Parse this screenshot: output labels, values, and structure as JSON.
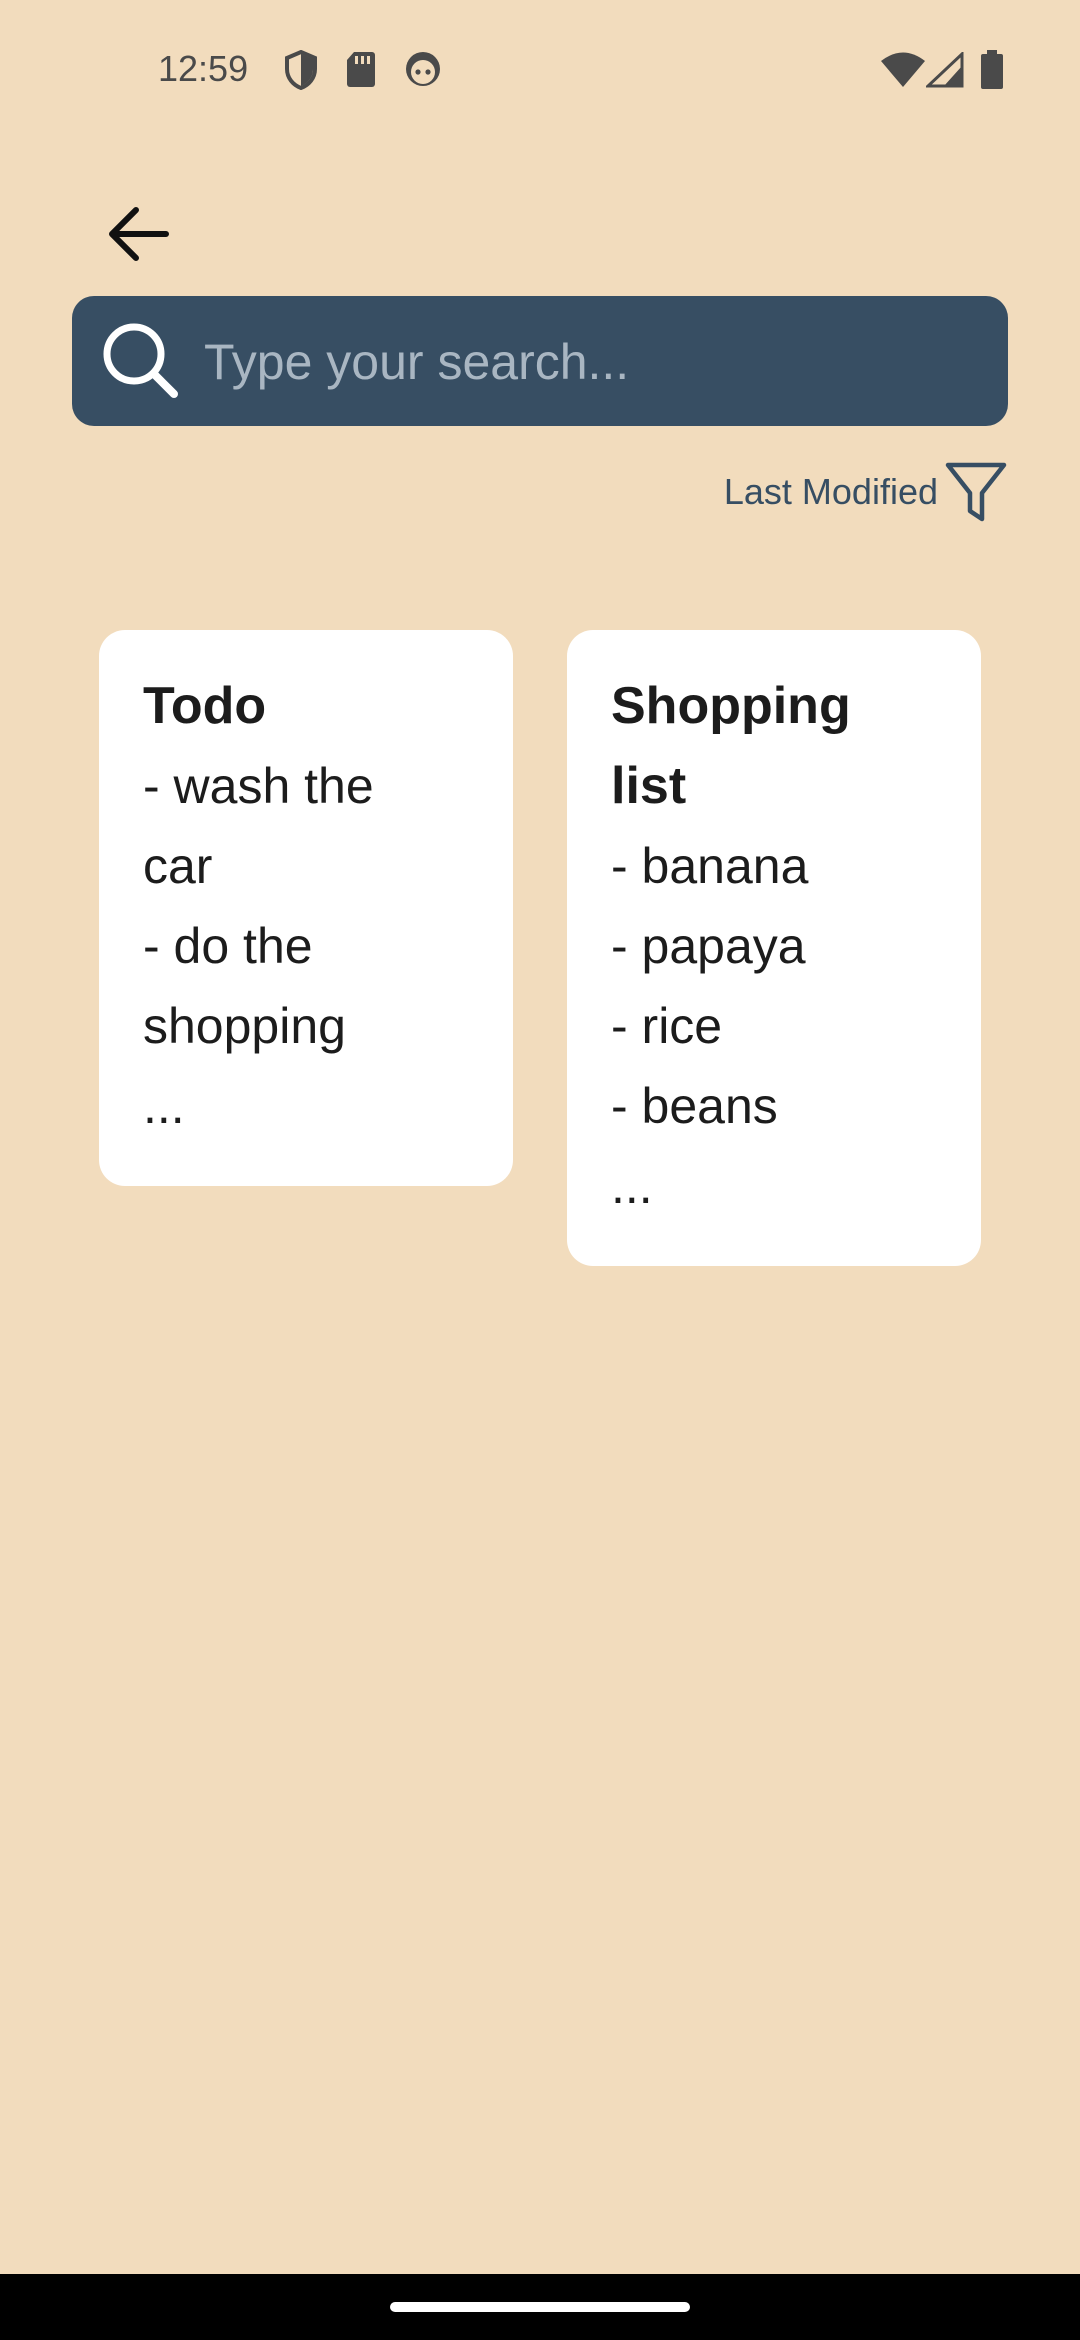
{
  "status_bar": {
    "time": "12:59",
    "icons_left": [
      "shield-icon",
      "sd-card-icon",
      "android-face-icon"
    ],
    "icons_right": [
      "wifi-icon",
      "signal-icon",
      "battery-icon"
    ]
  },
  "toolbar": {
    "back_icon": "arrow-back-icon"
  },
  "search": {
    "placeholder": "Type your search...",
    "value": "",
    "icon": "search-icon"
  },
  "sort": {
    "label": "Last Modified",
    "icon": "filter-icon"
  },
  "notes": [
    {
      "title": "Todo",
      "lines": [
        "- wash the",
        "car",
        "- do the",
        "shopping",
        "..."
      ]
    },
    {
      "title_lines": [
        "Shopping",
        "list"
      ],
      "lines": [
        "- banana",
        "- papaya",
        "- rice",
        "- beans",
        "..."
      ]
    }
  ],
  "colors": {
    "background": "#F2DCBD",
    "search_bar": "#374E63",
    "card": "#FFFFFF",
    "text": "#1C1C1C"
  }
}
